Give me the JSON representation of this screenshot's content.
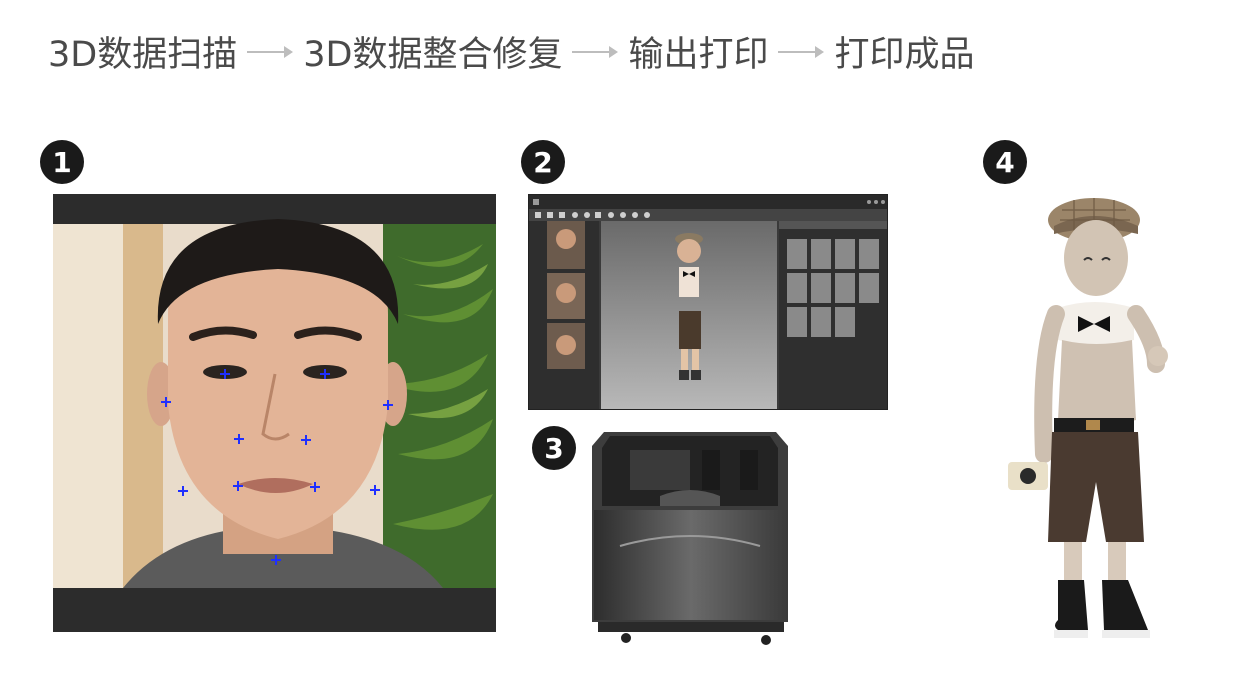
{
  "header": {
    "steps": [
      "3D数据扫描",
      "3D数据整合修复",
      "输出打印",
      "打印成品"
    ]
  },
  "badges": {
    "one": "1",
    "two": "2",
    "three": "3",
    "four": "4"
  },
  "colors": {
    "header_text": "#4a4a4a",
    "arrow": "#bdbdbd",
    "badge_bg": "#1a1a1a",
    "scan_marker": "#1f2fff"
  }
}
